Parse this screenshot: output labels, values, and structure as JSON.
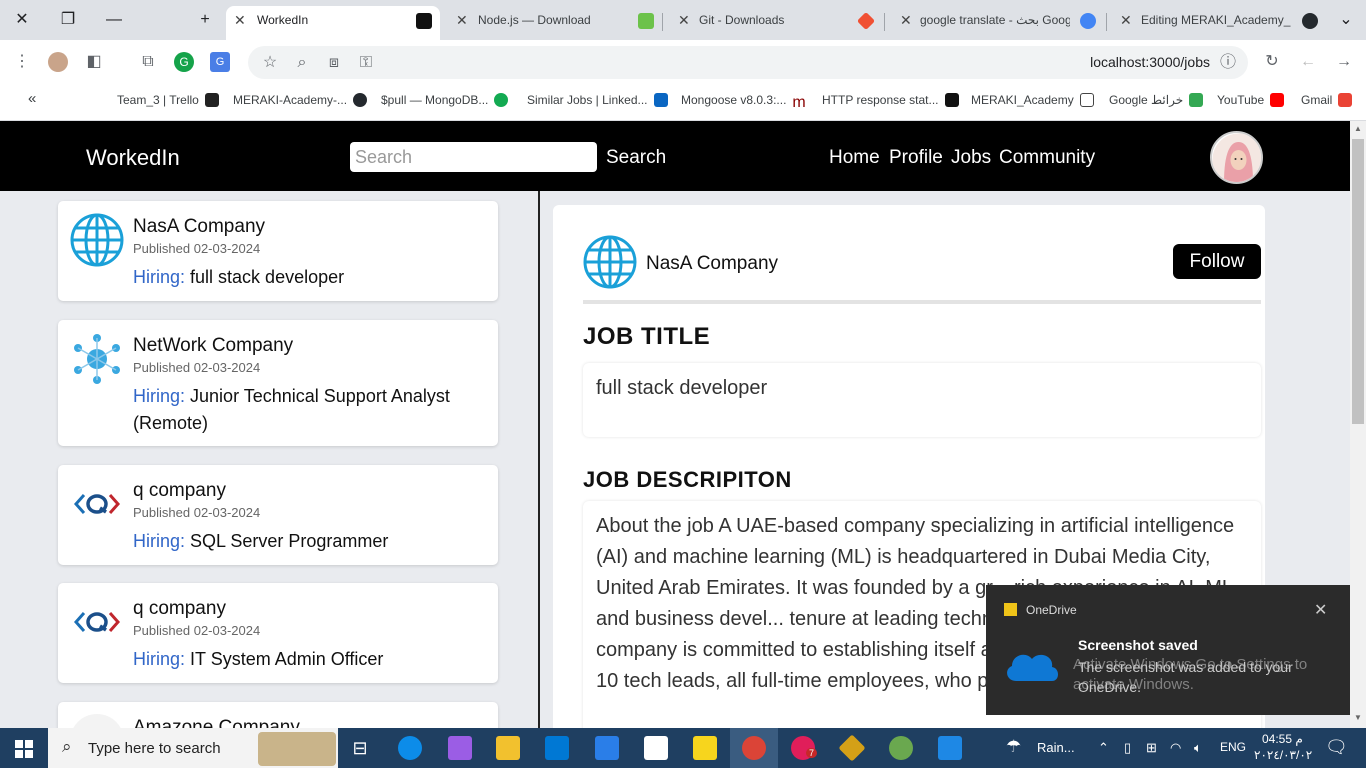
{
  "browser": {
    "tabs": [
      {
        "label": "WorkedIn",
        "active": true
      },
      {
        "label": "Node.js — Download",
        "active": false
      },
      {
        "label": "Git - Downloads",
        "active": false
      },
      {
        "label": "google translate - بحث Goog",
        "active": false
      },
      {
        "label": "Editing MERAKI_Academy_P",
        "active": false
      }
    ],
    "url": "localhost:3000/jobs",
    "bookmarks": [
      "Team_3 | Trello",
      "MERAKI-Academy-...",
      "$pull — MongoDB...",
      "Similar Jobs | Linked...",
      "Mongoose v8.0.3:...",
      "HTTP response stat...",
      "MERAKI_Academy",
      "Google خرائط",
      "YouTube",
      "Gmail"
    ]
  },
  "navbar": {
    "brand": "WorkedIn",
    "search_placeholder": "Search",
    "search_button": "Search",
    "links": [
      "Home",
      "Profile",
      "Jobs",
      "Community"
    ]
  },
  "jobs": [
    {
      "company": "NasA Company",
      "published": "Published 02-03-2024",
      "hiring_label": "Hiring:",
      "title": "full stack developer",
      "logo": "globe-icon"
    },
    {
      "company": "NetWork Company",
      "published": "Published 02-03-2024",
      "hiring_label": "Hiring:",
      "title": "Junior Technical Support Analyst (Remote)",
      "logo": "network-icon"
    },
    {
      "company": "q company",
      "published": "Published 02-03-2024",
      "hiring_label": "Hiring:",
      "title": "SQL Server Programmer",
      "logo": "q-logo-icon"
    },
    {
      "company": "q company",
      "published": "Published 02-03-2024",
      "hiring_label": "Hiring:",
      "title": "IT System Admin Officer",
      "logo": "q-logo-icon"
    },
    {
      "company": "Amazone Company",
      "published": "",
      "hiring_label": "",
      "title": "",
      "logo": "amazon-icon"
    }
  ],
  "detail": {
    "company": "NasA Company",
    "follow_label": "Follow",
    "job_title_heading": "JOB TITLE",
    "job_title": "full stack developer",
    "description_heading": "JOB DESCRIPITON",
    "description": "About the job A UAE-based company specializing in artificial intelligence (AI) and machine learning (ML) is headquartered in Dubai Media City, United Arab Emirates. It was founded by a gr... rich experience in AI, ML, and business devel... tenure at leading technology firms such as G... company is committed to establishing itself a... The team is comprised of 10 tech leads, all full-time employees, who play"
  },
  "toast": {
    "app": "OneDrive",
    "title": "Screenshot saved",
    "message": "The screenshot was added to your OneDrive.",
    "watermark": "Activate Windows Go to Settings to activate Windows."
  },
  "taskbar": {
    "search_placeholder": "Type here to search",
    "weather": "Rain...",
    "language": "ENG",
    "time": "04:55 م",
    "date": "٢٠٢٤/٠٣/٠٢",
    "notification_count": "7"
  },
  "colors": {
    "navbar": "#000000",
    "hiring_accent": "#3166c8",
    "follow_button": "#000000",
    "taskbar": "#1f3f61"
  }
}
